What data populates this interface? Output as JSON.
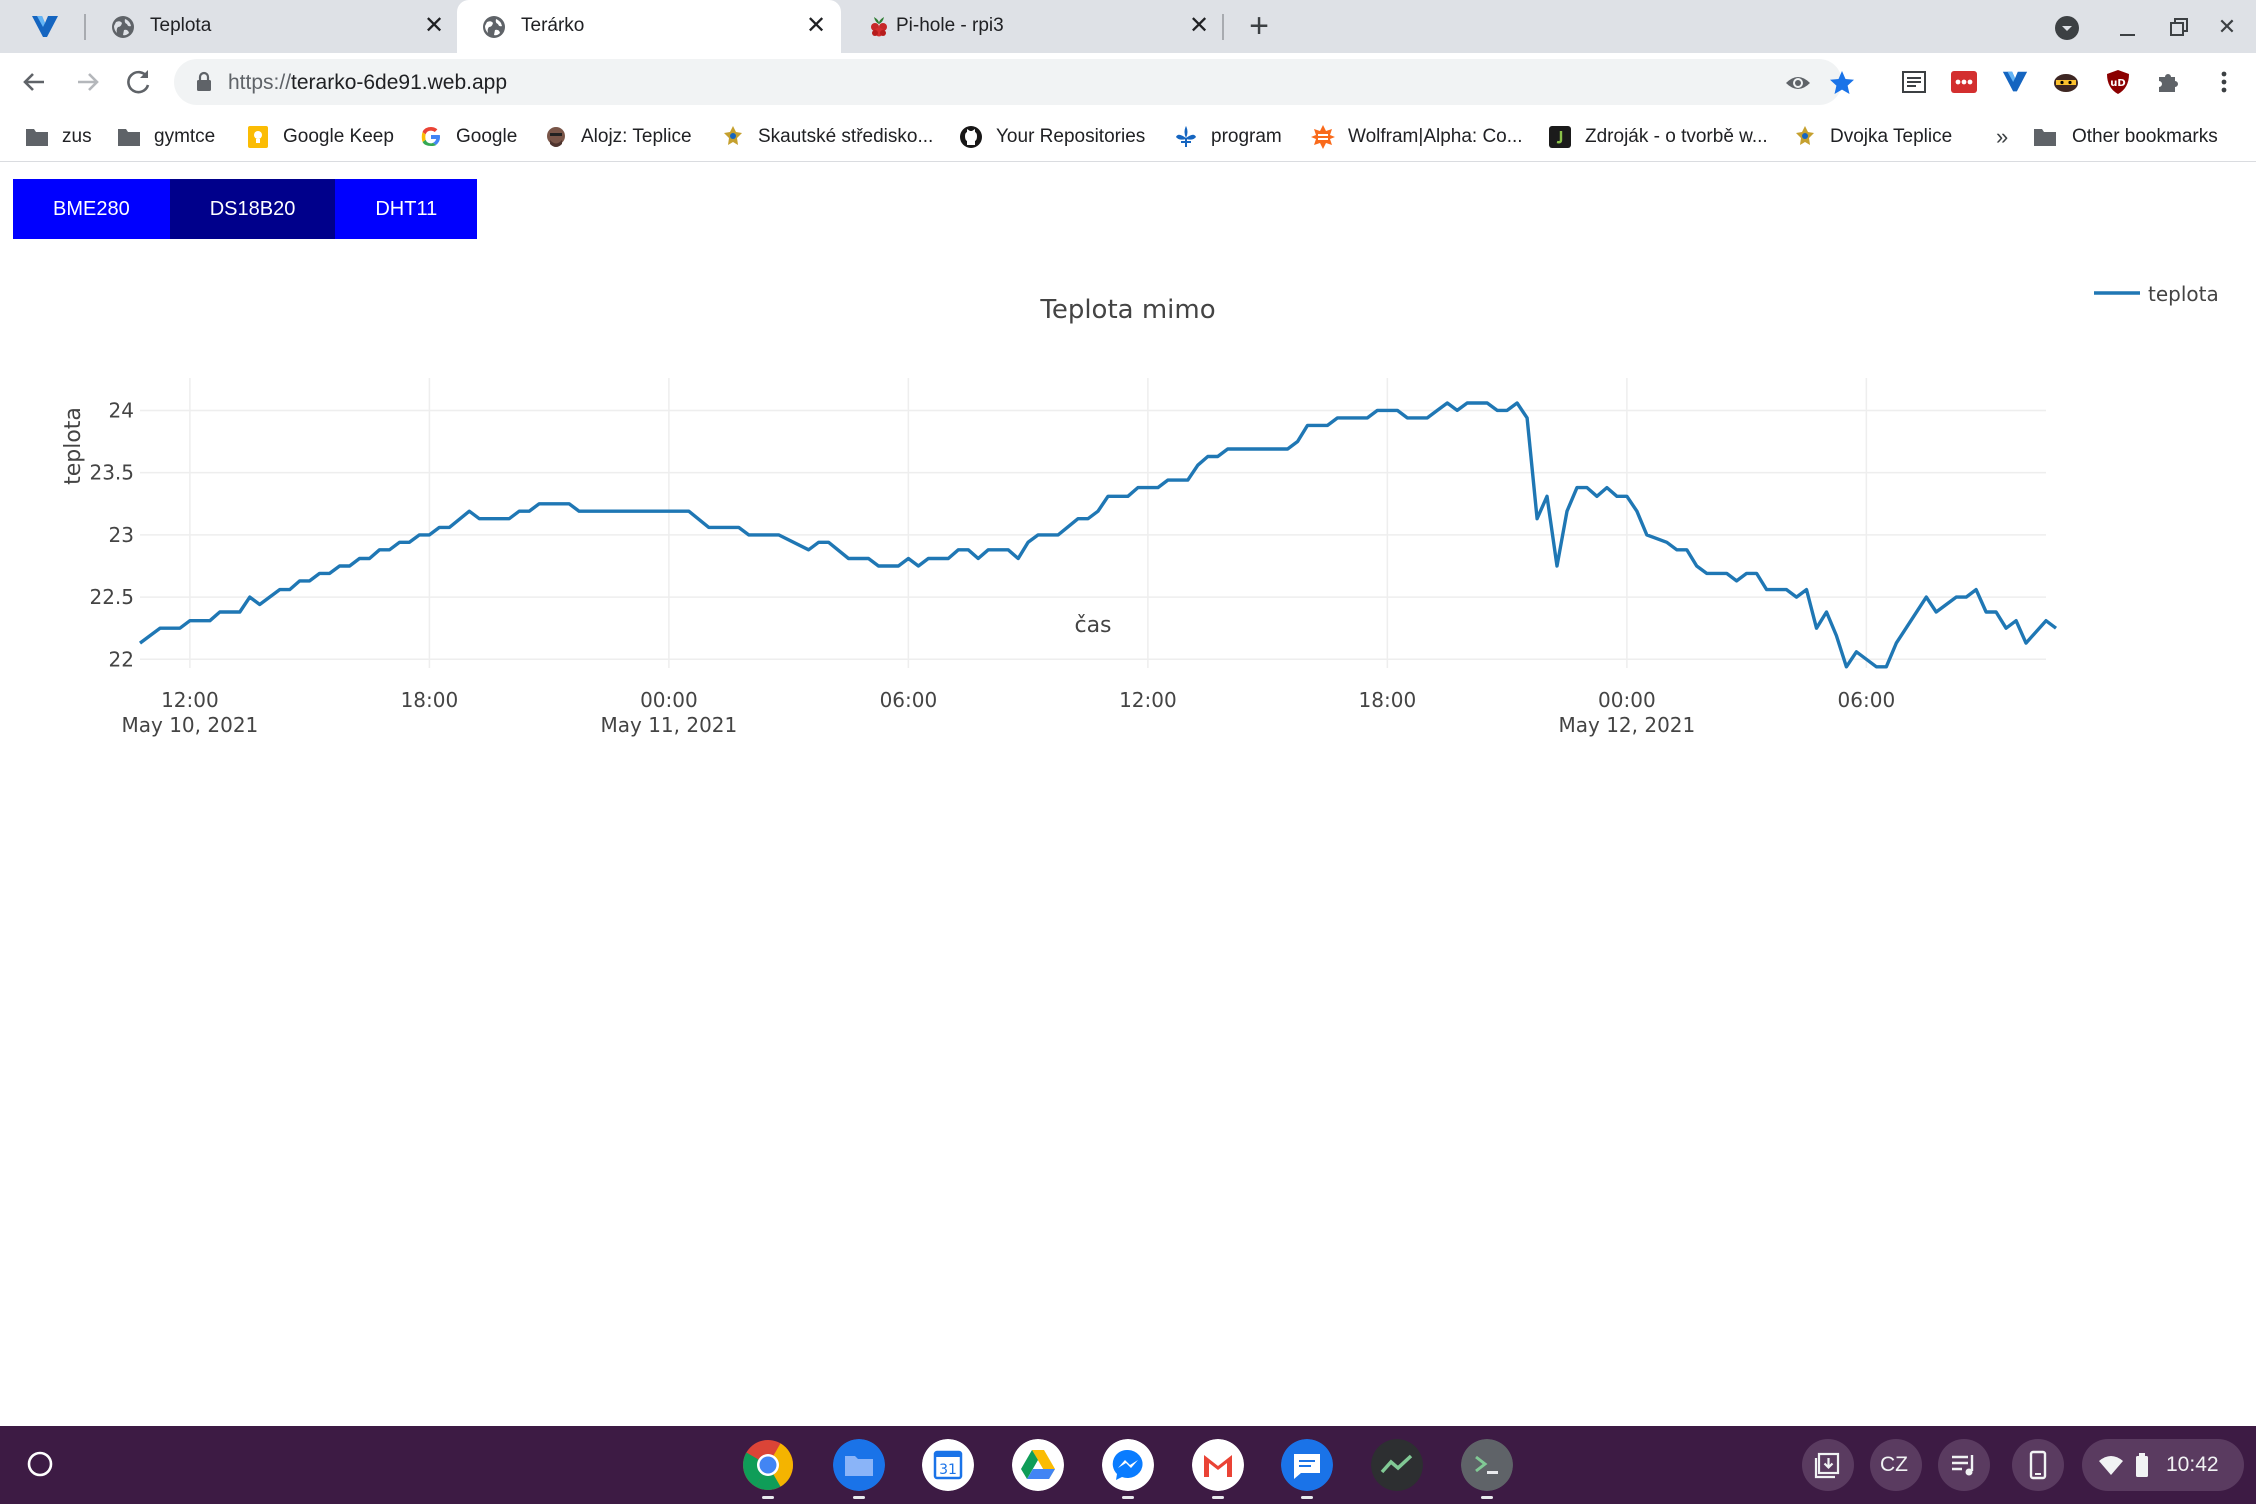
{
  "browser": {
    "tabs": [
      {
        "title": "Teplota",
        "active": false
      },
      {
        "title": "Terárko",
        "active": true
      },
      {
        "title": "Pi-hole - rpi3",
        "active": false
      }
    ],
    "url_scheme": "https://",
    "url_host": "terarko-6de91.web.app"
  },
  "bookmarks": [
    {
      "label": "zus",
      "icon": "folder-icon"
    },
    {
      "label": "gymtce",
      "icon": "folder-icon"
    },
    {
      "label": "Google Keep",
      "icon": "keep-icon"
    },
    {
      "label": "Google",
      "icon": "google-icon"
    },
    {
      "label": "Alojz: Teplice",
      "icon": "alojz-icon"
    },
    {
      "label": "Skautské středisko...",
      "icon": "scout-icon"
    },
    {
      "label": "Your Repositories",
      "icon": "github-icon"
    },
    {
      "label": "program",
      "icon": "fleur-icon"
    },
    {
      "label": "Wolfram|Alpha: Co...",
      "icon": "wolfram-icon"
    },
    {
      "label": "Zdroják - o tvorbě w...",
      "icon": "zdrojak-icon"
    },
    {
      "label": "Dvojka Teplice",
      "icon": "scout-icon"
    }
  ],
  "bookmarks_more": "»",
  "other_bookmarks": "Other bookmarks",
  "sensor_tabs": [
    {
      "label": "BME280",
      "selected": false
    },
    {
      "label": "DS18B20",
      "selected": true
    },
    {
      "label": "DHT11",
      "selected": false
    }
  ],
  "colors": {
    "sensor_button": "#0000ff",
    "sensor_button_selected": "#00008b",
    "series": "#1f77b4",
    "shelf": "#3d1b44"
  },
  "tray": {
    "keyboard": "CZ",
    "time": "10:42"
  },
  "chart_data": {
    "type": "line",
    "title": "Teplota mimo",
    "xlabel": "čas",
    "ylabel": "teplota",
    "x_start": "2021-05-10 10:45",
    "x_end": "2021-05-12 10:30",
    "ylim": [
      21.93,
      24.1
    ],
    "grid": true,
    "legend_position": "top-right",
    "x_ticks": [
      {
        "label": "12:00",
        "sublabel": "May 10, 2021",
        "time": "2021-05-10 12:00"
      },
      {
        "label": "18:00",
        "sublabel": "",
        "time": "2021-05-10 18:00"
      },
      {
        "label": "00:00",
        "sublabel": "May 11, 2021",
        "time": "2021-05-11 00:00"
      },
      {
        "label": "06:00",
        "sublabel": "",
        "time": "2021-05-11 06:00"
      },
      {
        "label": "12:00",
        "sublabel": "",
        "time": "2021-05-11 12:00"
      },
      {
        "label": "18:00",
        "sublabel": "",
        "time": "2021-05-11 18:00"
      },
      {
        "label": "00:00",
        "sublabel": "May 12, 2021",
        "time": "2021-05-12 00:00"
      },
      {
        "label": "06:00",
        "sublabel": "",
        "time": "2021-05-12 06:00"
      }
    ],
    "y_ticks": [
      {
        "label": "22",
        "value": 22
      },
      {
        "label": "22.5",
        "value": 22.5
      },
      {
        "label": "23",
        "value": 23
      },
      {
        "label": "23.5",
        "value": 23.5
      },
      {
        "label": "24",
        "value": 24
      }
    ],
    "series": [
      {
        "name": "teplota",
        "points": [
          [
            "2021-05-10 10:45",
            22.13
          ],
          [
            "2021-05-10 11:15",
            22.25
          ],
          [
            "2021-05-10 11:45",
            22.25
          ],
          [
            "2021-05-10 12:00",
            22.31
          ],
          [
            "2021-05-10 12:30",
            22.31
          ],
          [
            "2021-05-10 12:45",
            22.38
          ],
          [
            "2021-05-10 13:15",
            22.38
          ],
          [
            "2021-05-10 13:30",
            22.5
          ],
          [
            "2021-05-10 13:45",
            22.44
          ],
          [
            "2021-05-10 14:15",
            22.56
          ],
          [
            "2021-05-10 14:30",
            22.56
          ],
          [
            "2021-05-10 14:45",
            22.63
          ],
          [
            "2021-05-10 15:00",
            22.63
          ],
          [
            "2021-05-10 15:15",
            22.69
          ],
          [
            "2021-05-10 15:30",
            22.69
          ],
          [
            "2021-05-10 15:45",
            22.75
          ],
          [
            "2021-05-10 16:00",
            22.75
          ],
          [
            "2021-05-10 16:15",
            22.81
          ],
          [
            "2021-05-10 16:30",
            22.81
          ],
          [
            "2021-05-10 16:45",
            22.88
          ],
          [
            "2021-05-10 17:00",
            22.88
          ],
          [
            "2021-05-10 17:15",
            22.94
          ],
          [
            "2021-05-10 17:30",
            22.94
          ],
          [
            "2021-05-10 17:45",
            23.0
          ],
          [
            "2021-05-10 18:00",
            23.0
          ],
          [
            "2021-05-10 18:15",
            23.06
          ],
          [
            "2021-05-10 18:30",
            23.06
          ],
          [
            "2021-05-10 19:00",
            23.19
          ],
          [
            "2021-05-10 19:15",
            23.13
          ],
          [
            "2021-05-10 20:00",
            23.13
          ],
          [
            "2021-05-10 20:15",
            23.19
          ],
          [
            "2021-05-10 20:30",
            23.19
          ],
          [
            "2021-05-10 20:45",
            23.25
          ],
          [
            "2021-05-10 21:30",
            23.25
          ],
          [
            "2021-05-10 21:45",
            23.19
          ],
          [
            "2021-05-11 00:30",
            23.19
          ],
          [
            "2021-05-11 01:00",
            23.06
          ],
          [
            "2021-05-11 01:45",
            23.06
          ],
          [
            "2021-05-11 02:00",
            23.0
          ],
          [
            "2021-05-11 02:45",
            23.0
          ],
          [
            "2021-05-11 03:30",
            22.88
          ],
          [
            "2021-05-11 03:45",
            22.94
          ],
          [
            "2021-05-11 04:00",
            22.94
          ],
          [
            "2021-05-11 04:30",
            22.81
          ],
          [
            "2021-05-11 05:00",
            22.81
          ],
          [
            "2021-05-11 05:15",
            22.75
          ],
          [
            "2021-05-11 05:45",
            22.75
          ],
          [
            "2021-05-11 06:00",
            22.81
          ],
          [
            "2021-05-11 06:15",
            22.75
          ],
          [
            "2021-05-11 06:30",
            22.81
          ],
          [
            "2021-05-11 07:00",
            22.81
          ],
          [
            "2021-05-11 07:15",
            22.88
          ],
          [
            "2021-05-11 07:30",
            22.88
          ],
          [
            "2021-05-11 07:45",
            22.81
          ],
          [
            "2021-05-11 08:00",
            22.88
          ],
          [
            "2021-05-11 08:30",
            22.88
          ],
          [
            "2021-05-11 08:45",
            22.81
          ],
          [
            "2021-05-11 09:00",
            22.94
          ],
          [
            "2021-05-11 09:15",
            23.0
          ],
          [
            "2021-05-11 09:45",
            23.0
          ],
          [
            "2021-05-11 10:15",
            23.13
          ],
          [
            "2021-05-11 10:30",
            23.13
          ],
          [
            "2021-05-11 10:45",
            23.19
          ],
          [
            "2021-05-11 11:00",
            23.31
          ],
          [
            "2021-05-11 11:30",
            23.31
          ],
          [
            "2021-05-11 11:45",
            23.38
          ],
          [
            "2021-05-11 12:15",
            23.38
          ],
          [
            "2021-05-11 12:30",
            23.44
          ],
          [
            "2021-05-11 13:00",
            23.44
          ],
          [
            "2021-05-11 13:15",
            23.56
          ],
          [
            "2021-05-11 13:30",
            23.63
          ],
          [
            "2021-05-11 13:45",
            23.63
          ],
          [
            "2021-05-11 14:00",
            23.69
          ],
          [
            "2021-05-11 15:30",
            23.69
          ],
          [
            "2021-05-11 15:45",
            23.75
          ],
          [
            "2021-05-11 16:00",
            23.88
          ],
          [
            "2021-05-11 16:30",
            23.88
          ],
          [
            "2021-05-11 16:45",
            23.94
          ],
          [
            "2021-05-11 17:30",
            23.94
          ],
          [
            "2021-05-11 17:45",
            24.0
          ],
          [
            "2021-05-11 18:15",
            24.0
          ],
          [
            "2021-05-11 18:30",
            23.94
          ],
          [
            "2021-05-11 19:00",
            23.94
          ],
          [
            "2021-05-11 19:15",
            24.0
          ],
          [
            "2021-05-11 19:30",
            24.06
          ],
          [
            "2021-05-11 19:45",
            24.0
          ],
          [
            "2021-05-11 20:00",
            24.06
          ],
          [
            "2021-05-11 20:30",
            24.06
          ],
          [
            "2021-05-11 20:45",
            24.0
          ],
          [
            "2021-05-11 21:00",
            24.0
          ],
          [
            "2021-05-11 21:15",
            24.06
          ],
          [
            "2021-05-11 21:30",
            23.94
          ],
          [
            "2021-05-11 21:45",
            23.13
          ],
          [
            "2021-05-11 22:00",
            23.31
          ],
          [
            "2021-05-11 22:15",
            22.75
          ],
          [
            "2021-05-11 22:30",
            23.19
          ],
          [
            "2021-05-11 22:45",
            23.38
          ],
          [
            "2021-05-11 23:00",
            23.38
          ],
          [
            "2021-05-11 23:15",
            23.31
          ],
          [
            "2021-05-11 23:30",
            23.38
          ],
          [
            "2021-05-11 23:45",
            23.31
          ],
          [
            "2021-05-12 00:00",
            23.31
          ],
          [
            "2021-05-12 00:15",
            23.19
          ],
          [
            "2021-05-12 00:30",
            23.0
          ],
          [
            "2021-05-12 01:00",
            22.94
          ],
          [
            "2021-05-12 01:15",
            22.88
          ],
          [
            "2021-05-12 01:30",
            22.88
          ],
          [
            "2021-05-12 01:45",
            22.75
          ],
          [
            "2021-05-12 02:00",
            22.69
          ],
          [
            "2021-05-12 02:30",
            22.69
          ],
          [
            "2021-05-12 02:45",
            22.63
          ],
          [
            "2021-05-12 03:00",
            22.69
          ],
          [
            "2021-05-12 03:15",
            22.69
          ],
          [
            "2021-05-12 03:30",
            22.56
          ],
          [
            "2021-05-12 04:00",
            22.56
          ],
          [
            "2021-05-12 04:15",
            22.5
          ],
          [
            "2021-05-12 04:30",
            22.56
          ],
          [
            "2021-05-12 04:45",
            22.25
          ],
          [
            "2021-05-12 05:00",
            22.38
          ],
          [
            "2021-05-12 05:15",
            22.19
          ],
          [
            "2021-05-12 05:30",
            21.94
          ],
          [
            "2021-05-12 05:45",
            22.06
          ],
          [
            "2021-05-12 06:15",
            21.94
          ],
          [
            "2021-05-12 06:30",
            21.94
          ],
          [
            "2021-05-12 06:45",
            22.13
          ],
          [
            "2021-05-12 07:30",
            22.5
          ],
          [
            "2021-05-12 07:45",
            22.38
          ],
          [
            "2021-05-12 08:15",
            22.5
          ],
          [
            "2021-05-12 08:30",
            22.5
          ],
          [
            "2021-05-12 08:45",
            22.56
          ],
          [
            "2021-05-12 09:00",
            22.38
          ],
          [
            "2021-05-12 09:15",
            22.38
          ],
          [
            "2021-05-12 09:30",
            22.25
          ],
          [
            "2021-05-12 09:45",
            22.31
          ],
          [
            "2021-05-12 10:00",
            22.13
          ],
          [
            "2021-05-12 10:30",
            22.31
          ],
          [
            "2021-05-12 10:45",
            22.25
          ]
        ]
      }
    ]
  }
}
